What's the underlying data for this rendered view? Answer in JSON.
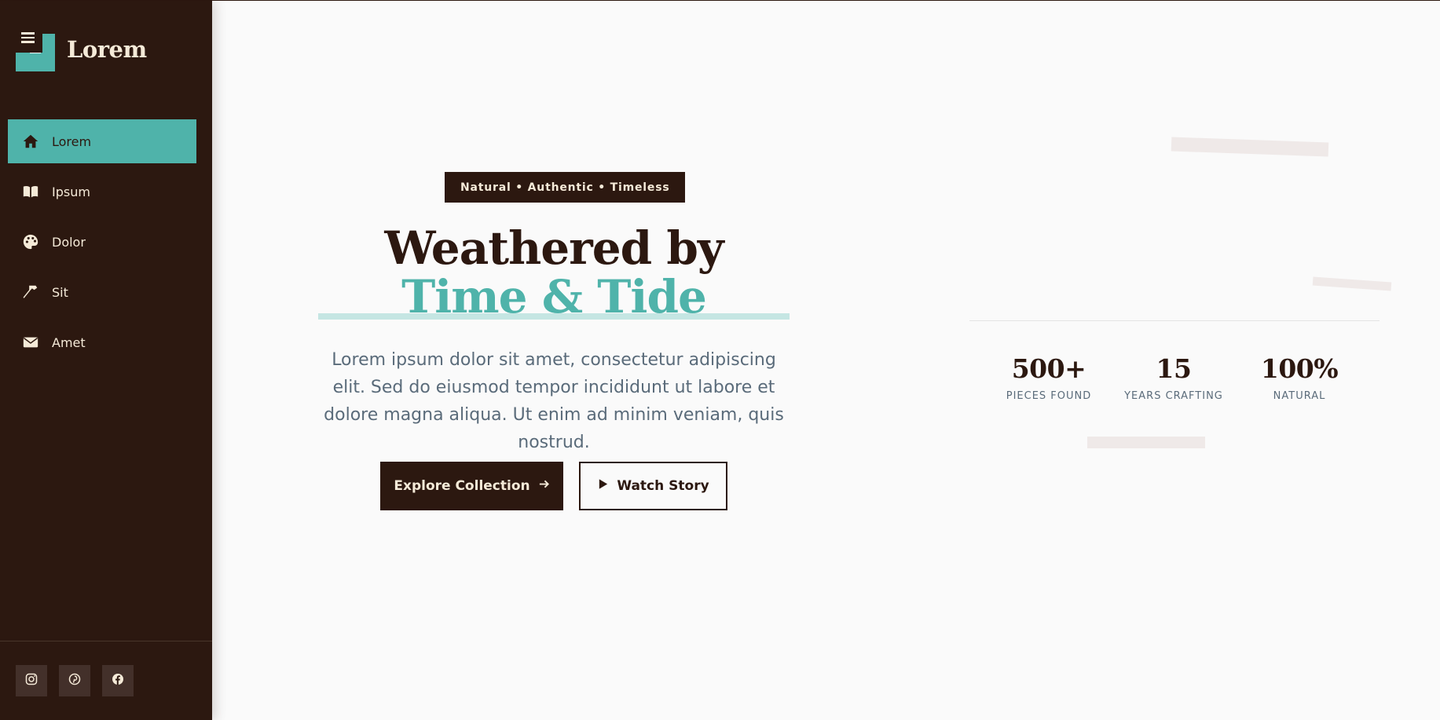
{
  "brand": {
    "name": "Lorem"
  },
  "nav": {
    "items": [
      {
        "label": "Lorem",
        "icon": "home-icon",
        "active": true
      },
      {
        "label": "Ipsum",
        "icon": "book-icon"
      },
      {
        "label": "Dolor",
        "icon": "palette-icon"
      },
      {
        "label": "Sit",
        "icon": "hammer-icon"
      },
      {
        "label": "Amet",
        "icon": "envelope-icon"
      }
    ]
  },
  "socials": [
    {
      "icon": "instagram-icon"
    },
    {
      "icon": "pinterest-icon"
    },
    {
      "icon": "facebook-icon"
    }
  ],
  "hero": {
    "tagline": "Natural • Authentic • Timeless",
    "headline_line1": "Weathered by",
    "headline_line2": "Time & Tide",
    "description": "Lorem ipsum dolor sit amet, consectetur adipiscing elit. Sed do eiusmod tempor incididunt ut labore et dolore magna aliqua. Ut enim ad minim veniam, quis nostrud.",
    "primary_button": "Explore Collection",
    "secondary_button": "Watch Story"
  },
  "stats": [
    {
      "value": "500+",
      "label": "PIECES FOUND"
    },
    {
      "value": "15",
      "label": "YEARS CRAFTING"
    },
    {
      "value": "100%",
      "label": "NATURAL"
    }
  ],
  "colors": {
    "sidebar_bg": "#2c1810",
    "accent": "#4fb3aa",
    "cream": "#f5ead8",
    "page_bg": "#fafafa",
    "body_text": "#5a6b7a"
  }
}
